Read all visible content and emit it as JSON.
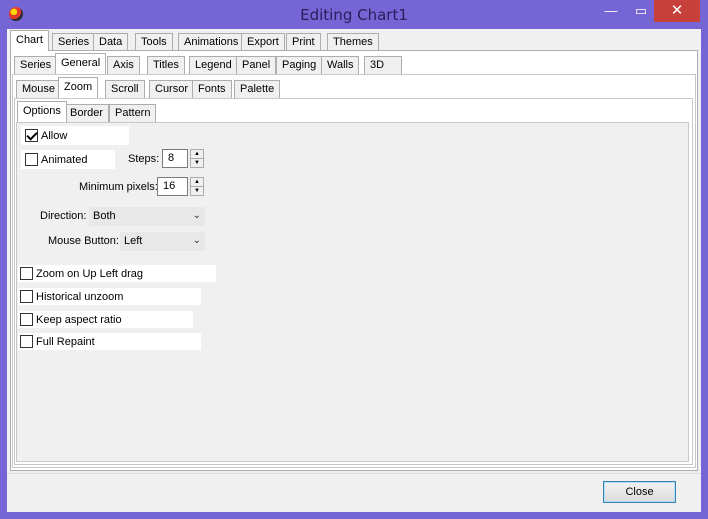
{
  "window": {
    "title": "Editing Chart1",
    "min_glyph": "—",
    "max_glyph": "▭",
    "close_glyph": "✕"
  },
  "tabs_main": [
    "Chart",
    "Series",
    "Data",
    "Tools",
    "Animations",
    "Export",
    "Print",
    "Themes"
  ],
  "tabs_sub": [
    "Series",
    "General",
    "Axis",
    "Titles",
    "Legend",
    "Panel",
    "Paging",
    "Walls",
    "3D"
  ],
  "tabs_general": [
    "Mouse",
    "Zoom",
    "Scroll",
    "Cursor",
    "Fonts",
    "Palette"
  ],
  "tabs_zoom": [
    "Options",
    "Border",
    "Pattern"
  ],
  "zoom": {
    "allow_label": "Allow",
    "allow_checked": true,
    "animated_label": "Animated",
    "animated_checked": false,
    "steps_label": "Steps:",
    "steps_value": "8",
    "min_pixels_label": "Minimum pixels:",
    "min_pixels_value": "16",
    "direction_label": "Direction:",
    "direction_value": "Both",
    "mouse_button_label": "Mouse Button:",
    "mouse_button_value": "Left",
    "zoom_on_up_left_label": "Zoom on Up Left drag",
    "historical_label": "Historical unzoom",
    "keep_aspect_label": "Keep aspect ratio",
    "full_repaint_label": "Full Repaint"
  },
  "buttons": {
    "close": "Close"
  },
  "colors": {
    "frame": "#7565d5",
    "close_btn": "#c7403a",
    "dialog_bg": "#f0f0f0"
  }
}
